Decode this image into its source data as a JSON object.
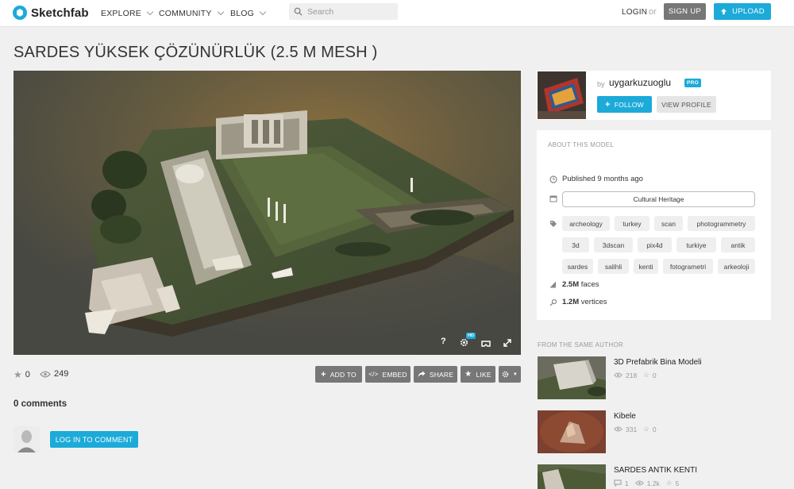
{
  "header": {
    "logo_text": "Sketchfab",
    "nav": [
      {
        "label": "EXPLORE"
      },
      {
        "label": "COMMUNITY"
      },
      {
        "label": "BLOG"
      }
    ],
    "search_placeholder": "Search",
    "login": "LOGIN",
    "or": "or",
    "signup": "SIGN UP",
    "upload": "UPLOAD"
  },
  "model": {
    "title": "SARDES YÜKSEK ÇÖZÜNÜRLÜK (2.5 M MESH )",
    "likes": "0",
    "views": "249"
  },
  "viewer_controls": {
    "help": "?",
    "hd_badge": "HD"
  },
  "actions": {
    "add_to": "ADD TO",
    "embed": "EMBED",
    "share": "SHARE",
    "like": "LIKE"
  },
  "comments": {
    "count": "0 comments",
    "login_button": "LOG IN TO COMMENT"
  },
  "author": {
    "by": "by",
    "name": "uygarkuzuoglu",
    "badge": "PRO",
    "follow": "FOLLOW",
    "view_profile": "VIEW PROFILE"
  },
  "about": {
    "heading": "ABOUT THIS MODEL",
    "published": "Published 9 months ago",
    "category": "Cultural Heritage",
    "tags": [
      "archeology",
      "turkey",
      "scan",
      "photogrammetry",
      "3d",
      "3dscan",
      "pix4d",
      "turkiye",
      "antik",
      "sardes",
      "salihli",
      "kenti",
      "fotogrametri",
      "arkeoloji"
    ],
    "faces_value": "2.5M",
    "faces_label": "faces",
    "vertices_value": "1.2M",
    "vertices_label": "vertices"
  },
  "related": {
    "heading": "FROM THE SAME AUTHOR",
    "items": [
      {
        "title": "3D Prefabrik Bina Modeli",
        "views": "218",
        "likes": "0"
      },
      {
        "title": "Kibele",
        "views": "331",
        "likes": "0"
      },
      {
        "title": "SARDES ANTIK KENTI",
        "comments": "1",
        "views": "1.2k",
        "likes": "5"
      }
    ]
  },
  "colors": {
    "accent": "#1caad9",
    "button_grey": "#777777",
    "page_bg": "#f0f0f0"
  }
}
